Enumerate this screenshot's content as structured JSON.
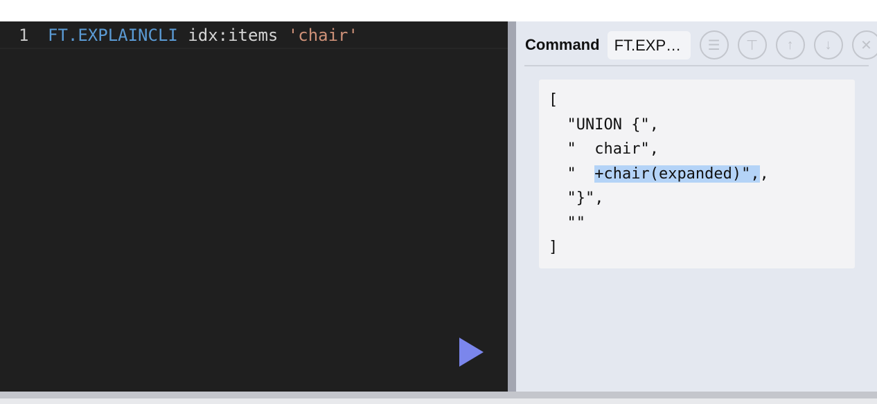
{
  "editor": {
    "line_number": "1",
    "command": "FT.EXPLAINCLI",
    "args": " idx:items ",
    "string_arg": "'chair'"
  },
  "panel": {
    "title": "Command",
    "command_truncated": "FT.EXP…",
    "buttons": [
      {
        "name": "list-icon",
        "glyph": "☰"
      },
      {
        "name": "paint-roller-icon",
        "glyph": "⊤"
      },
      {
        "name": "arrow-up-icon",
        "glyph": "↑"
      },
      {
        "name": "arrow-down-icon",
        "glyph": "↓"
      },
      {
        "name": "close-icon",
        "glyph": "✕"
      }
    ],
    "output": {
      "l0": "[",
      "l1": "  \"UNION {\",",
      "l2": "  \"  chair\",",
      "l3a": "  \"  ",
      "l3b": "+chair(expanded)\",",
      "l3c": ",",
      "l4": "  \"}\",",
      "l5": "  \"\"",
      "l6": "]"
    }
  },
  "colors": {
    "keyword": "#5b9bd5",
    "string": "#ce9178",
    "run": "#7b86ec",
    "selection": "#b4d3f7"
  }
}
